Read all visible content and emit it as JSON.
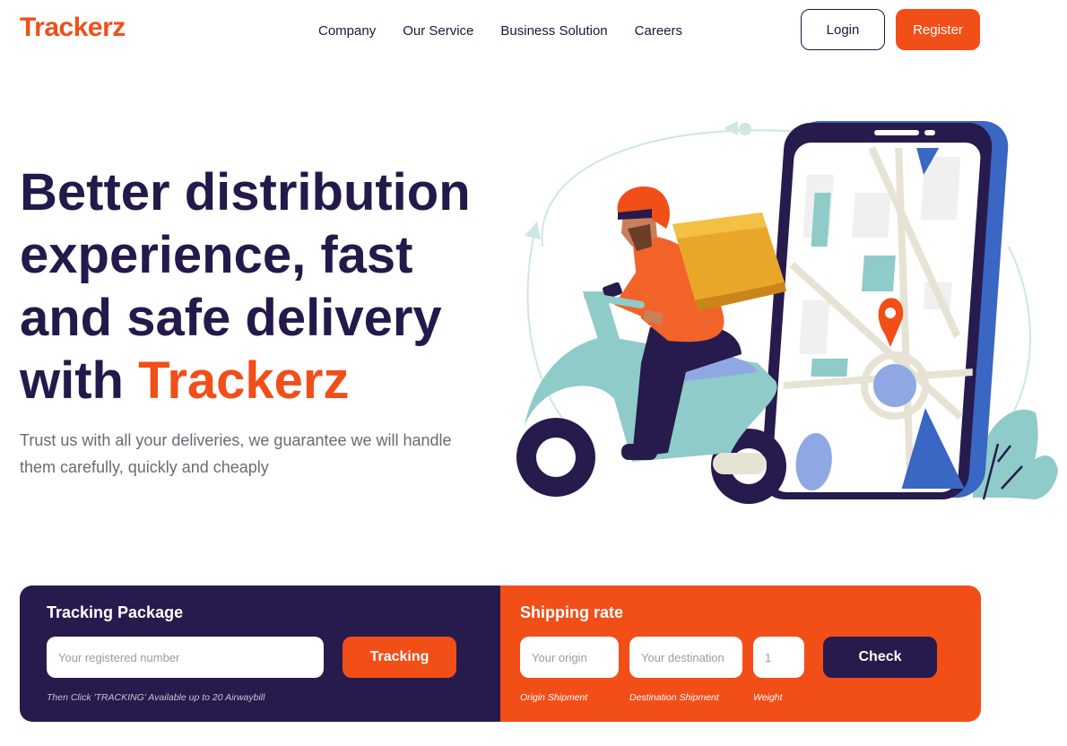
{
  "header": {
    "logo": "Trackerz",
    "nav": [
      "Company",
      "Our Service",
      "Business Solution",
      "Careers"
    ],
    "login_label": "Login",
    "register_label": "Register"
  },
  "hero": {
    "title_part1": "Better distribution experience, fast and safe delivery with ",
    "title_accent": "Trackerz",
    "subtitle": "Trust us with all your deliveries, we guarantee we will handle them carefully, quickly and cheaply"
  },
  "tracking": {
    "title": "Tracking Package",
    "placeholder": "Your registered number",
    "button_label": "Tracking",
    "hint": "Then Click 'TRACKING' Available up to 20 Airwaybill"
  },
  "shipping": {
    "title": "Shipping rate",
    "origin_placeholder": "Your origin",
    "destination_placeholder": "Your destination",
    "weight_placeholder": "1",
    "button_label": "Check",
    "origin_hint": "Origin Shipment",
    "destination_hint": "Destination Shipment",
    "weight_hint": "Weight"
  },
  "colors": {
    "brand_orange": "#f24e18",
    "navy": "#271a4d",
    "mint": "#8fcbc8"
  }
}
